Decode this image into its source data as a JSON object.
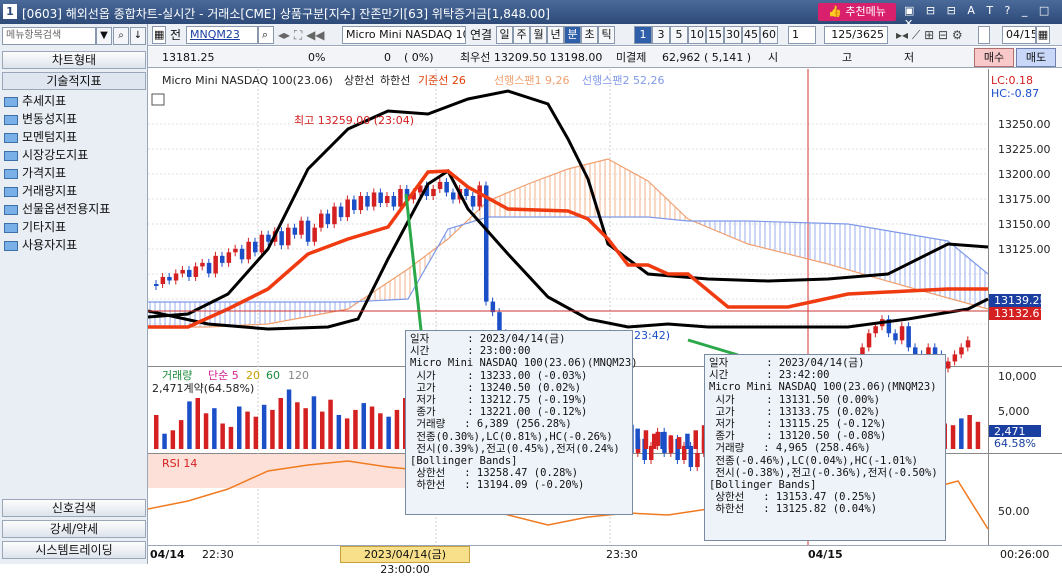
{
  "window": {
    "num": "1",
    "title": "[0603] 해외선옵 종합차트-실시간 - 거래소[CME] 상품구분[지수] 잔존만기[63] 위탁증거금[1,848.00]",
    "recommend": "추천메뉴",
    "icons": "▣ ⊟ ⊟ A T ? _ □ ✕"
  },
  "left": {
    "search_placeholder": "메뉴항목검색",
    "top_button": "차트형태",
    "section": "기술적지표",
    "items": [
      "추세지표",
      "변동성지표",
      "모멘텀지표",
      "시장강도지표",
      "가격지표",
      "거래량지표",
      "선물옵션전용지표",
      "기타지표",
      "사용자지표"
    ],
    "bottom": [
      "신호검색",
      "강세/약세",
      "시스템트레이딩"
    ]
  },
  "toolbar": {
    "jeon": "전",
    "code": "MNQM23",
    "name": "Micro Mini NASDAQ 10",
    "link": "연결",
    "periods": [
      "일",
      "주",
      "월",
      "년",
      "분",
      "초",
      "틱"
    ],
    "nums": [
      "1",
      "3",
      "5",
      "10",
      "15",
      "30",
      "45",
      "60"
    ],
    "interval": "1",
    "count": "125/3625",
    "date": "04/15"
  },
  "info": {
    "price": "13181.25",
    "pct1": "0%",
    "vol": "0",
    "pct2": "( 0%)",
    "best": "최우선 13209.50 13198.00",
    "unsettled": "미결제",
    "oi": "62,962 ( 5,141 )",
    "si": "시",
    "go": "고",
    "jeo": "저",
    "buy": "매수",
    "sell": "매도"
  },
  "chart": {
    "legend": "Micro Mini NASDAQ 100(23.06)",
    "legend_upper": "상한선",
    "legend_lower": "하한선",
    "legend_kijun": "기준선 26",
    "legend_span1": "선행스팬1 9,26",
    "legend_span2": "선행스팬2 52,26",
    "lc": "LC:0.18",
    "hc": "HC:-0.87",
    "high_note": "최고 13259.00 (23:04)",
    "low_note": "23:42)",
    "y_ticks": [
      "13250.00",
      "13225.00",
      "13200.00",
      "13175.00",
      "13150.00",
      "13125.00"
    ],
    "price_tag1": "13139.25",
    "price_tag2": "13132.67",
    "vol_legend": "거래량",
    "vol_ma": "단순 5",
    "ma20": "20",
    "ma60": "60",
    "ma120": "120",
    "vol_note": "2,471계약(64.58%)",
    "vol_ticks": [
      "10,000",
      "5,000",
      "0"
    ],
    "vol_tag": "2,471",
    "vol_pct": "64.58%",
    "rsi_label": "RSI 14",
    "rsi_ticks": [
      "50.00"
    ]
  },
  "tip1": "일자      : 2023/04/14(금)\n시간      : 23:00:00\nMicro Mini NASDAQ 100(23.06)(MNQM23)\n 시가     : 13233.00 (-0.03%)\n 고가     : 13240.50 (0.02%)\n 저가     : 13212.75 (-0.19%)\n 종가     : 13221.00 (-0.12%)\n 거래량   : 6,389 (256.28%)\n 전종(0.30%),LC(0.81%),HC(-0.26%)\n 전시(0.39%),전고(0.45%),전저(0.24%)\n[Bollinger Bands]\n 상한선   : 13258.47 (0.28%)\n 하한선   : 13194.09 (-0.20%)",
  "tip2": "일자      : 2023/04/14(금)\n시간      : 23:42:00\nMicro Mini NASDAQ 100(23.06)(MNQM23)\n 시가     : 13131.50 (0.00%)\n 고가     : 13133.75 (0.02%)\n 저가     : 13115.25 (-0.12%)\n 종가     : 13120.50 (-0.08%)\n 거래량   : 4,965 (258.46%)\n 전종(-0.46%),LC(0.04%),HC(-1.01%)\n 전시(-0.38%),전고(-0.36%),전저(-0.50%)\n[Bollinger Bands]\n 상한선   : 13153.47 (0.25%)\n 하한선   : 13125.82 (0.04%)",
  "bottom": {
    "d1": "04/14",
    "t1": "22:30",
    "hl": "2023/04/14(금) 23:00:00",
    "t2": "23:30",
    "d2": "04/15",
    "t3": "00:26:00"
  }
}
